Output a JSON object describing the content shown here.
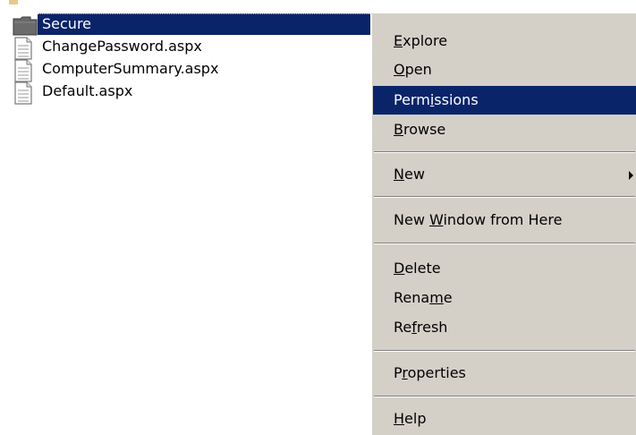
{
  "files": [
    {
      "name": "Secure",
      "type": "folder",
      "selected": true
    },
    {
      "name": "ChangePassword.aspx",
      "type": "file",
      "selected": false
    },
    {
      "name": "ComputerSummary.aspx",
      "type": "file",
      "selected": false
    },
    {
      "name": "Default.aspx",
      "type": "file",
      "selected": false
    }
  ],
  "context_menu": {
    "items": [
      {
        "label": "Explore",
        "mnemonic": "E",
        "highlighted": false
      },
      {
        "label": "Open",
        "mnemonic": "O",
        "highlighted": false
      },
      {
        "label": "Permissions",
        "mnemonic": "i",
        "highlighted": true
      },
      {
        "label": "Browse",
        "mnemonic": "B",
        "highlighted": false
      },
      {
        "label": "New",
        "mnemonic": "N",
        "highlighted": false,
        "has_submenu": true
      },
      {
        "label": "New Window from Here",
        "mnemonic": "W",
        "highlighted": false
      },
      {
        "label": "Delete",
        "mnemonic": "D",
        "highlighted": false
      },
      {
        "label": "Rename",
        "mnemonic": "m",
        "highlighted": false
      },
      {
        "label": "Refresh",
        "mnemonic": "f",
        "highlighted": false
      },
      {
        "label": "Properties",
        "mnemonic": "r",
        "highlighted": false
      },
      {
        "label": "Help",
        "mnemonic": "H",
        "highlighted": false
      }
    ]
  },
  "colors": {
    "selection": "#0a246a",
    "menu_bg": "#d4d0c8",
    "folder": "#6b6b6b"
  },
  "icons": {
    "folder": "folder-icon",
    "file": "document-icon",
    "submenu": "chevron-right-icon"
  }
}
